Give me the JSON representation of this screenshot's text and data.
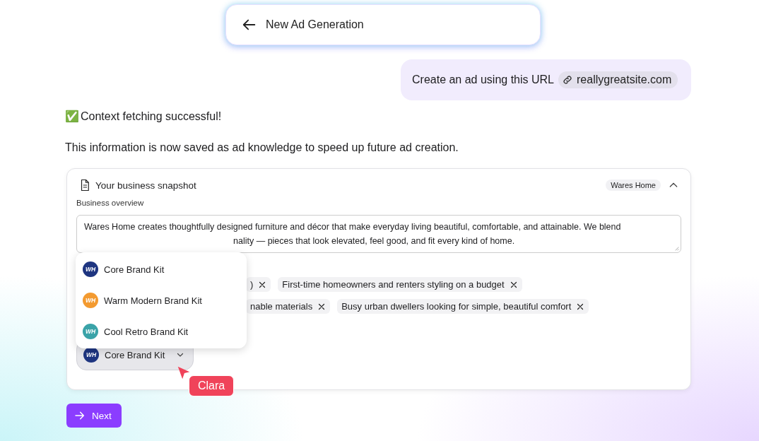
{
  "header": {
    "title": "New Ad Generation"
  },
  "user_message": {
    "text": "Create an ad using this URL",
    "link": "reallygreatsite.com"
  },
  "status_message": {
    "emoji": "✅",
    "text": "Context fetching successful!"
  },
  "info_text": "This information is now saved as ad knowledge to speed up future ad creation.",
  "snapshot_card": {
    "title": "Your business snapshot",
    "tag": "Wares Home",
    "expanded": true,
    "overview_label": "Business overview",
    "overview_lines": [
      "Wares Home creates thoughtfully designed furniture and décor that make everyday living beautiful, comfortable, and attainable. We blend",
      "nality — pieces that look elevated, feel good, and fit every kind of home."
    ],
    "audience_rows": [
      [
        ")",
        "First-time homeowners and renters styling on a budget"
      ],
      [
        "nable materials",
        "Busy urban dwellers looking for simple, beautiful comfort"
      ]
    ],
    "brand_kit_menu": [
      {
        "logo": "WH",
        "label": "Core Brand Kit",
        "color": "#1e3580"
      },
      {
        "logo": "WH",
        "label": "Warm Modern Brand Kit",
        "color": "#f39a30"
      },
      {
        "logo": "WH",
        "label": "Cool Retro Brand Kit",
        "color": "#3aa3a8"
      }
    ],
    "brand_kit_select": {
      "logo": "WH",
      "label": "Core Brand Kit",
      "color": "#1e3580"
    }
  },
  "cursor": {
    "name": "Clara"
  },
  "buttons": [
    {
      "label": "Next"
    }
  ]
}
